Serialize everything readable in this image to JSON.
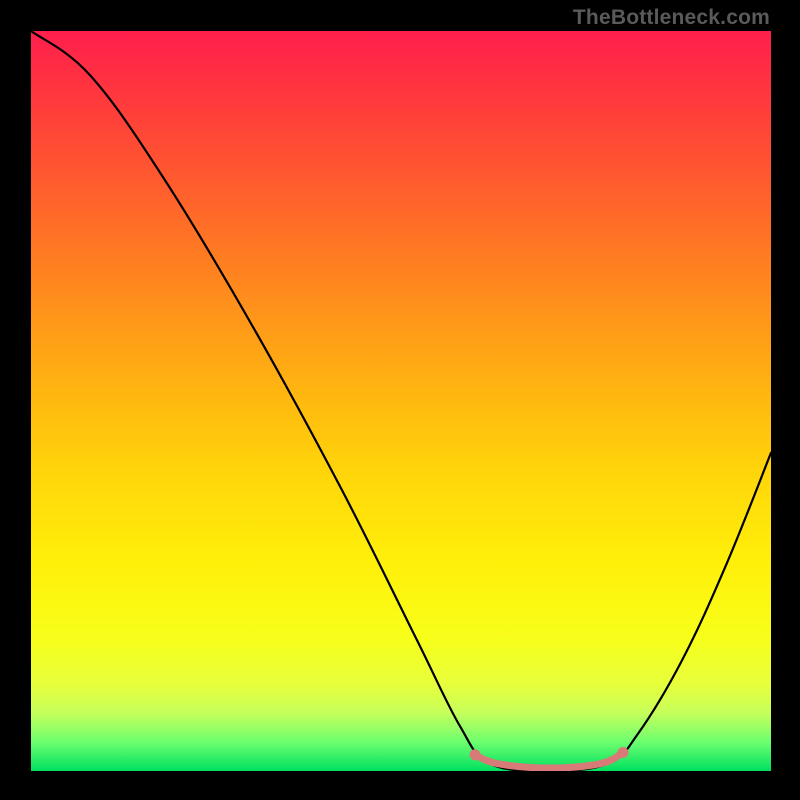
{
  "watermark": {
    "text": "TheBottleneck.com"
  },
  "chart_data": {
    "type": "line",
    "title": "",
    "xlabel": "",
    "ylabel": "",
    "xlim": [
      0,
      100
    ],
    "ylim": [
      0,
      100
    ],
    "grid": false,
    "legend": false,
    "annotations": [],
    "series": [
      {
        "name": "bottleneck-curve",
        "points": [
          {
            "x": 0,
            "y": 100
          },
          {
            "x": 8,
            "y": 94
          },
          {
            "x": 18,
            "y": 80
          },
          {
            "x": 30,
            "y": 60
          },
          {
            "x": 42,
            "y": 38
          },
          {
            "x": 52,
            "y": 18
          },
          {
            "x": 58,
            "y": 6
          },
          {
            "x": 62,
            "y": 1
          },
          {
            "x": 70,
            "y": 0
          },
          {
            "x": 78,
            "y": 1
          },
          {
            "x": 82,
            "y": 5
          },
          {
            "x": 88,
            "y": 15
          },
          {
            "x": 94,
            "y": 28
          },
          {
            "x": 100,
            "y": 43
          }
        ],
        "color": "#000000"
      },
      {
        "name": "optimal-zone",
        "points": [
          {
            "x": 60,
            "y": 2.2
          },
          {
            "x": 63,
            "y": 1.0
          },
          {
            "x": 70,
            "y": 0.4
          },
          {
            "x": 77,
            "y": 1.0
          },
          {
            "x": 80,
            "y": 2.5
          }
        ],
        "color": "#d87a78"
      }
    ],
    "background_gradient": {
      "direction": "top-to-bottom",
      "stops": [
        {
          "pos": 0,
          "color": "#ff1f4d"
        },
        {
          "pos": 50,
          "color": "#ffb90f"
        },
        {
          "pos": 82,
          "color": "#f7ff1a"
        },
        {
          "pos": 100,
          "color": "#00e060"
        }
      ]
    }
  }
}
